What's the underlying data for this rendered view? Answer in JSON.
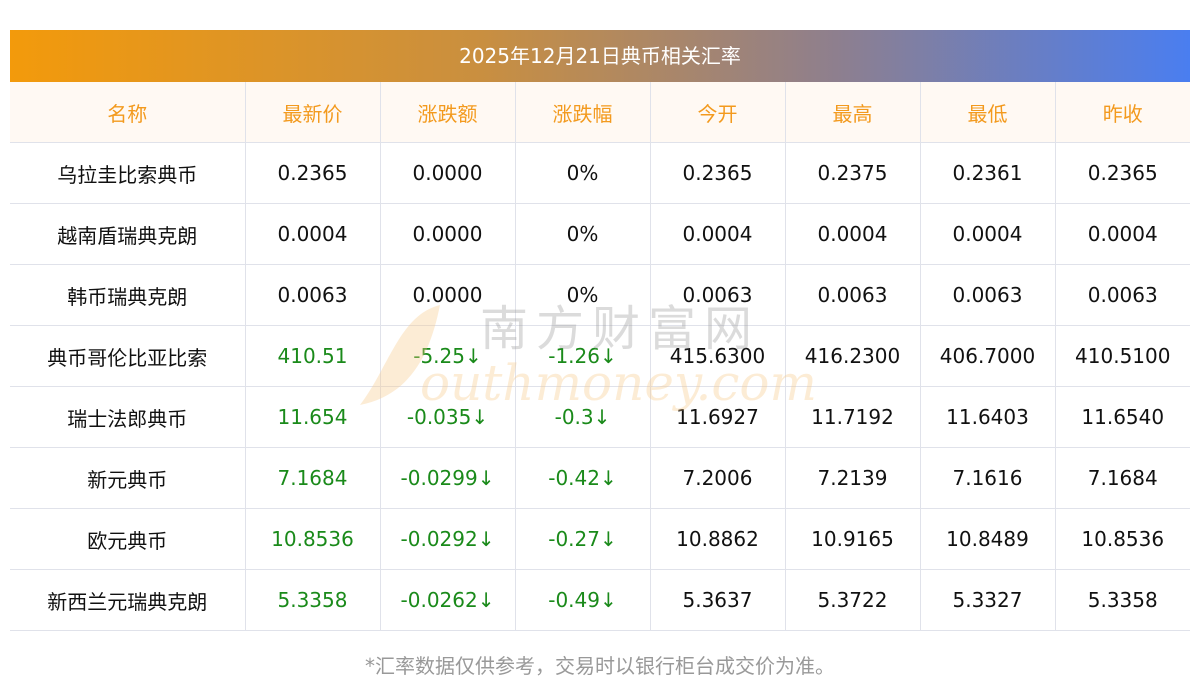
{
  "title": "2025年12月21日典币相关汇率",
  "headers": [
    "名称",
    "最新价",
    "涨跌额",
    "涨跌幅",
    "今开",
    "最高",
    "最低",
    "昨收"
  ],
  "rows": [
    [
      "乌拉圭比索典币",
      "0.2365",
      "0.0000",
      "0%",
      "0.2365",
      "0.2375",
      "0.2361",
      "0.2365"
    ],
    [
      "越南盾瑞典克朗",
      "0.0004",
      "0.0000",
      "0%",
      "0.0004",
      "0.0004",
      "0.0004",
      "0.0004"
    ],
    [
      "韩币瑞典克朗",
      "0.0063",
      "0.0000",
      "0%",
      "0.0063",
      "0.0063",
      "0.0063",
      "0.0063"
    ],
    [
      "典币哥伦比亚比索",
      "410.51",
      "-5.25↓",
      "-1.26↓",
      "415.6300",
      "416.2300",
      "406.7000",
      "410.5100"
    ],
    [
      "瑞士法郎典币",
      "11.654",
      "-0.035↓",
      "-0.3↓",
      "11.6927",
      "11.7192",
      "11.6403",
      "11.6540"
    ],
    [
      "新元典币",
      "7.1684",
      "-0.0299↓",
      "-0.42↓",
      "7.2006",
      "7.2139",
      "7.1616",
      "7.1684"
    ],
    [
      "欧元典币",
      "10.8536",
      "-0.0292↓",
      "-0.27↓",
      "10.8862",
      "10.9165",
      "10.8489",
      "10.8536"
    ],
    [
      "新西兰元瑞典克朗",
      "5.3358",
      "-0.0262↓",
      "-0.49↓",
      "5.3637",
      "5.3722",
      "5.3327",
      "5.3358"
    ]
  ],
  "green_rows": [
    3,
    4,
    5,
    6,
    7
  ],
  "footer": "*汇率数据仅供参考，交易时以银行柜台成交价为准。",
  "watermark": {
    "cn": "南方财富网",
    "en": "Southmoney.com"
  },
  "colors": {
    "header_text": "#f39a1e",
    "down": "#1a8a1a"
  }
}
